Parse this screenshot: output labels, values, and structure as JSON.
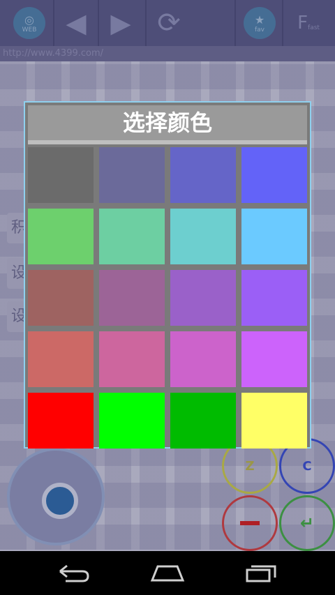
{
  "dialog": {
    "title": "选择颜色",
    "swatches": [
      "#6b6b6b",
      "#6b6a9a",
      "#6565c8",
      "#6363f8",
      "#6dd06d",
      "#6dcfa2",
      "#6dcfcf",
      "#6bcaff",
      "#9e6361",
      "#9c6497",
      "#9a61c9",
      "#9b5ff6",
      "#cc6966",
      "#cd669e",
      "#cc63cb",
      "#cc63fb",
      "#ff0000",
      "#00ff00",
      "#00bb00",
      "#ffff66"
    ]
  },
  "background": {
    "url": "http://www.4399.com/",
    "web_label": "WEB",
    "fav_label": "fav",
    "f_label": "F",
    "f_sub": "fast",
    "field_labels": [
      "积",
      "设",
      "设"
    ],
    "game_buttons": {
      "z": "Z",
      "c": "C"
    }
  },
  "colors": {
    "dialog_border": "#8fd0ee",
    "title_bg": "#9a9a9a",
    "grid_bg": "#7a7a7a"
  }
}
